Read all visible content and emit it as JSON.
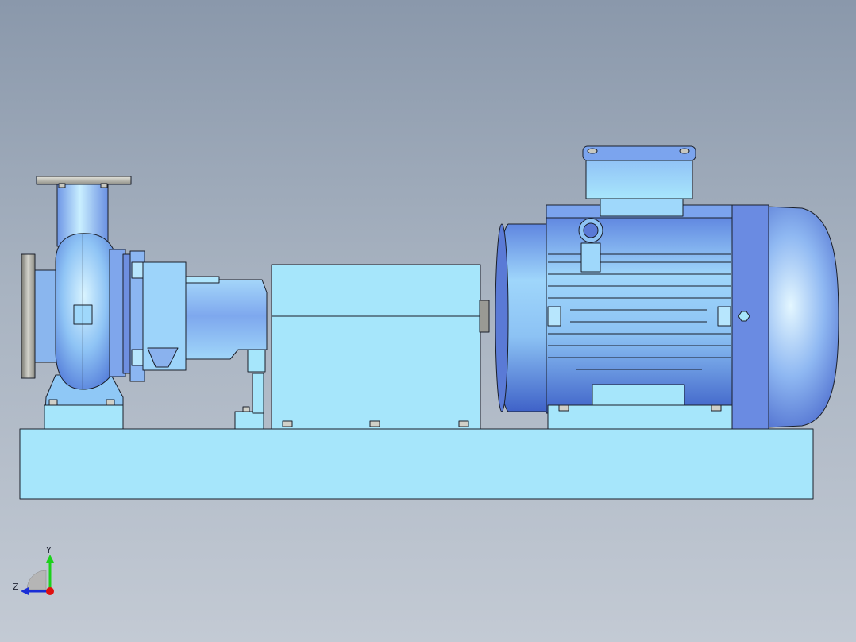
{
  "viewport": {
    "background_top": "#8a98ab",
    "background_bottom": "#c3cad4"
  },
  "model": {
    "part_fill": "#a6e6fb",
    "edge_color": "#1a1f2a",
    "shaded_blue": "#6f94e8",
    "metal_gray": "#b8b8b0"
  },
  "triad": {
    "y_label": "Y",
    "z_label": "Z",
    "y_color": "#1bd11b",
    "z_color": "#1a2ed6",
    "x_color": "#e01010"
  }
}
